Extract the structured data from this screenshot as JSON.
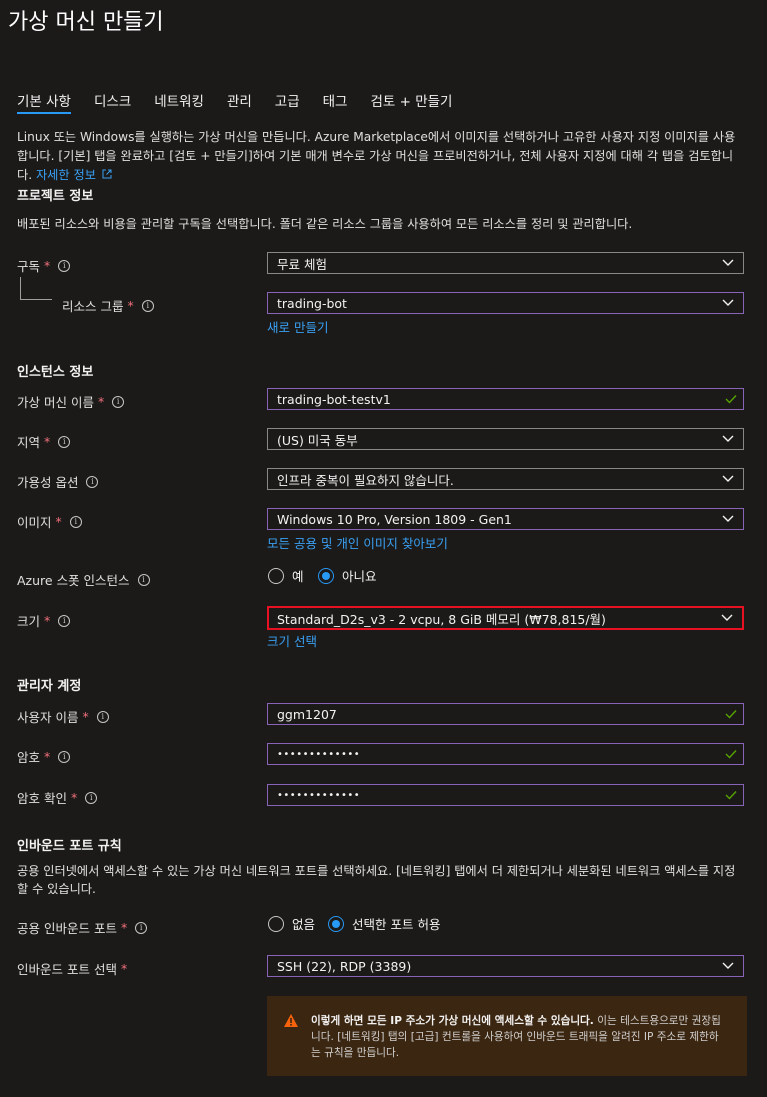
{
  "page": {
    "title": "가상 머신 만들기"
  },
  "tabs": [
    "기본 사항",
    "디스크",
    "네트워킹",
    "관리",
    "고급",
    "태그",
    "검토 + 만들기"
  ],
  "intro": {
    "text": "Linux 또는 Windows를 실행하는 가상 머신을 만듭니다. Azure Marketplace에서 이미지를 선택하거나 고유한 사용자 지정 이미지를 사용합니다. [기본] 탭을 완료하고 [검토 + 만들기]하여 기본 매개 변수로 가상 머신을 프로비전하거나, 전체 사용자 지정에 대해 각 탭을 검토합니다.",
    "link": "자세한 정보"
  },
  "project": {
    "heading": "프로젝트 정보",
    "description": "배포된 리소스와 비용을 관리할 구독을 선택합니다. 폴더 같은 리소스 그룹을 사용하여 모든 리소스를 정리 및 관리합니다.",
    "subscription_label": "구독",
    "subscription_value": "무료 체험",
    "resource_group_label": "리소스 그룹",
    "resource_group_value": "trading-bot",
    "create_new_link": "새로 만들기"
  },
  "instance": {
    "heading": "인스턴스 정보",
    "vm_name_label": "가상 머신 이름",
    "vm_name_value": "trading-bot-testv1",
    "region_label": "지역",
    "region_value": "(US) 미국 동부",
    "availability_label": "가용성 옵션",
    "availability_value": "인프라 중복이 필요하지 않습니다.",
    "image_label": "이미지",
    "image_value": "Windows 10 Pro, Version 1809 - Gen1",
    "browse_images_link": "모든 공용 및 개인 이미지 찾아보기",
    "spot_label": "Azure 스폿 인스턴스",
    "spot_yes": "예",
    "spot_no": "아니요",
    "size_label": "크기",
    "size_value": "Standard_D2s_v3 - 2 vcpu, 8 GiB 메모리 (₩78,815/월)",
    "select_size_link": "크기 선택"
  },
  "admin": {
    "heading": "관리자 계정",
    "username_label": "사용자 이름",
    "username_value": "ggm1207",
    "password_label": "암호",
    "password_value": "•••••••••••••",
    "confirm_label": "암호 확인",
    "confirm_value": "•••••••••••••"
  },
  "inbound": {
    "heading": "인바운드 포트 규칙",
    "description": "공용 인터넷에서 액세스할 수 있는 가상 머신 네트워크 포트를 선택하세요. [네트워킹] 탭에서 더 제한되거나 세분화된 네트워크 액세스를 지정할 수 있습니다.",
    "public_ports_label": "공용 인바운드 포트",
    "option_none": "없음",
    "option_allow": "선택한 포트 허용",
    "select_ports_label": "인바운드 포트 선택",
    "select_ports_value": "SSH (22), RDP (3389)",
    "warning_bold": "이렇게 하면 모든 IP 주소가 가상 머신에 액세스할 수 있습니다.",
    "warning_text": "이는 테스트용으로만 권장됩니다. [네트워킹] 탭의 [고급] 컨트롤을 사용하여 인바운드 트래픽을 알려진 IP 주소로 제한하는 규칙을 만듭니다."
  },
  "colors": {
    "background": "#1b1a19",
    "accent": "#2899f5",
    "link": "#3aa0f3",
    "required": "#f1707b",
    "error": "#e81123",
    "valid": "#8764b8",
    "check": "#57a300",
    "warning_bg": "#3b2611",
    "warning_icon": "#f7630c"
  },
  "icons": [
    "info-icon",
    "chevron-down-icon",
    "checkmark-icon",
    "external-link-icon",
    "warning-icon"
  ]
}
